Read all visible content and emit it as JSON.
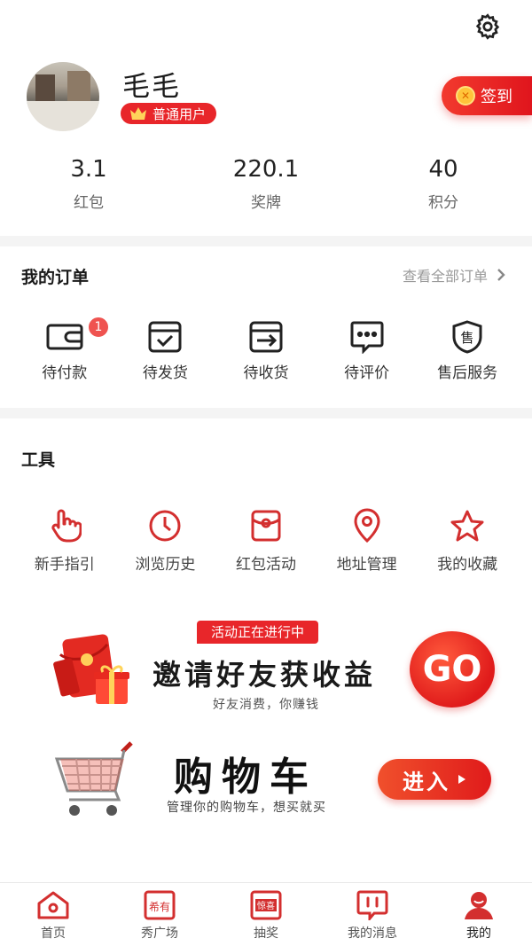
{
  "profile": {
    "username": "毛毛",
    "level": "普通用户",
    "sign_in": "签到"
  },
  "stats": [
    {
      "value": "3.1",
      "label": "红包"
    },
    {
      "value": "220.1",
      "label": "奖牌"
    },
    {
      "value": "40",
      "label": "积分"
    }
  ],
  "orders": {
    "title": "我的订单",
    "view_all": "查看全部订单",
    "items": [
      {
        "label": "待付款",
        "icon": "wallet-icon",
        "badge": "1"
      },
      {
        "label": "待发货",
        "icon": "box-check-icon"
      },
      {
        "label": "待收货",
        "icon": "box-arrow-icon"
      },
      {
        "label": "待评价",
        "icon": "comment-icon"
      },
      {
        "label": "售后服务",
        "icon": "shield-icon",
        "icon_text": "售"
      }
    ]
  },
  "tools": {
    "title": "工具",
    "items": [
      {
        "label": "新手指引",
        "icon": "hand-pointer-icon"
      },
      {
        "label": "浏览历史",
        "icon": "clock-icon"
      },
      {
        "label": "红包活动",
        "icon": "red-envelope-icon"
      },
      {
        "label": "地址管理",
        "icon": "location-pin-icon"
      },
      {
        "label": "我的收藏",
        "icon": "star-icon"
      }
    ]
  },
  "invite_banner": {
    "tag": "活动正在进行中",
    "title": "邀请好友获收益",
    "subtitle": "好友消费，你赚钱",
    "button": "GO"
  },
  "cart_banner": {
    "title": "购物车",
    "subtitle": "管理你的购物车，想买就买",
    "button": "进入"
  },
  "tabbar": [
    {
      "label": "首页",
      "icon": "home-icon"
    },
    {
      "label": "秀广场",
      "icon": "show-square-icon",
      "icon_text": "希有"
    },
    {
      "label": "抽奖",
      "icon": "lottery-icon",
      "icon_text": "惊喜"
    },
    {
      "label": "我的消息",
      "icon": "message-icon"
    },
    {
      "label": "我的",
      "icon": "user-icon",
      "active": true
    }
  ],
  "colors": {
    "accent": "#e8262a",
    "icon": "#d32f2f"
  }
}
